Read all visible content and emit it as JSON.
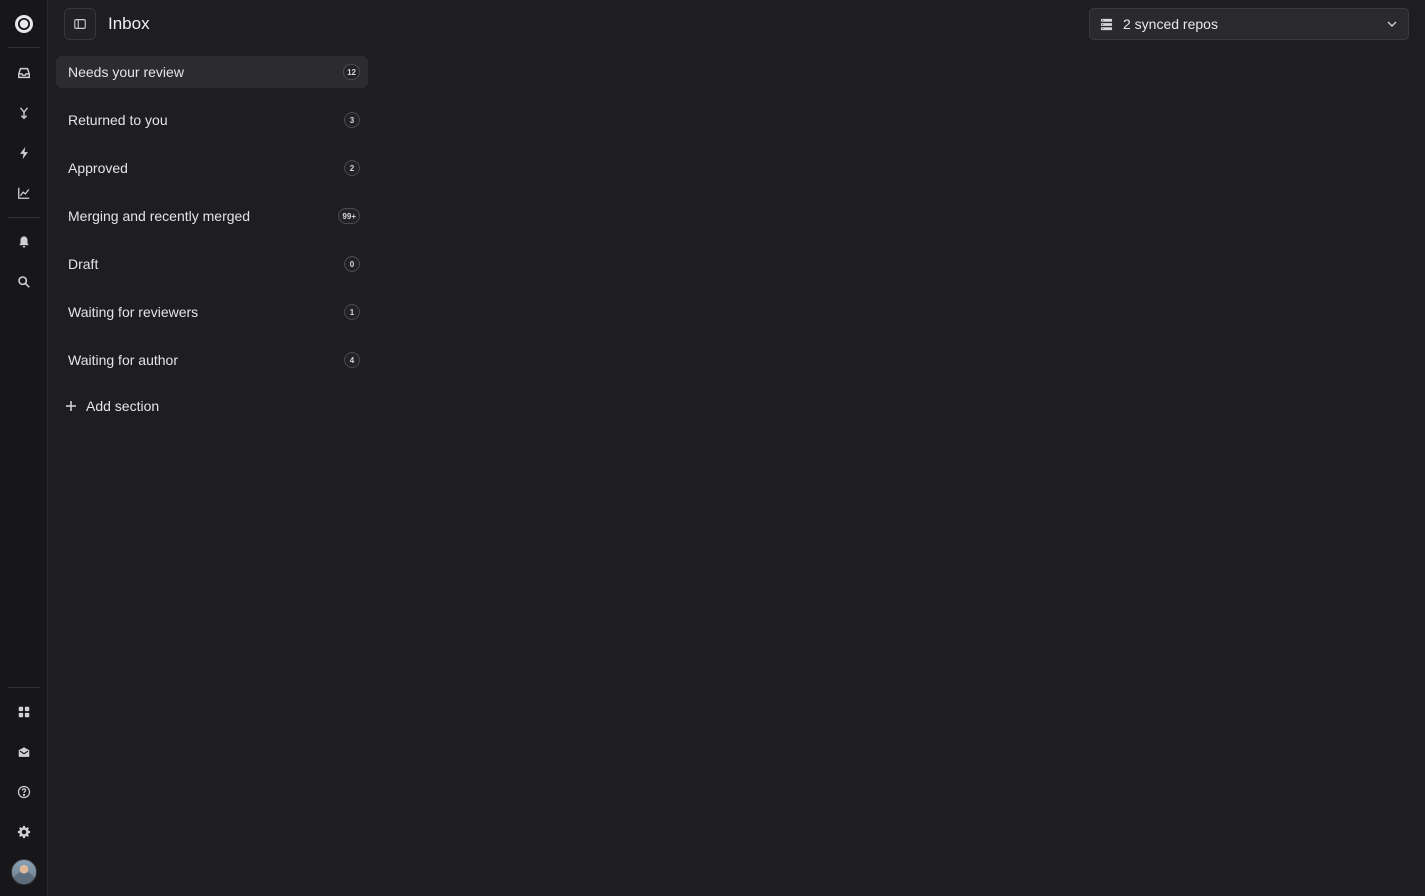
{
  "app": {
    "page_title": "Inbox"
  },
  "rail": {
    "top_icons": [
      "logo-icon",
      "inbox-icon",
      "merge-icon",
      "bolt-icon",
      "chart-icon",
      "bell-icon",
      "search-icon"
    ],
    "bottom_icons": [
      "grid-icon",
      "mail-icon",
      "help-icon",
      "settings-icon",
      "avatar"
    ]
  },
  "header": {
    "repo_selector_label": "2 synced repos"
  },
  "sections": {
    "items": [
      {
        "label": "Needs your review",
        "count": "12",
        "active": true
      },
      {
        "label": "Returned to you",
        "count": "3",
        "active": false
      },
      {
        "label": "Approved",
        "count": "2",
        "active": false
      },
      {
        "label": "Merging and recently merged",
        "count": "99+",
        "active": false
      },
      {
        "label": "Draft",
        "count": "0",
        "active": false
      },
      {
        "label": "Waiting for reviewers",
        "count": "1",
        "active": false
      },
      {
        "label": "Waiting for author",
        "count": "4",
        "active": false
      }
    ],
    "add_label": "Add section"
  },
  "colors": {
    "background": "#1e1e20",
    "rail": "#17171a",
    "active_item": "#2c2c30"
  }
}
